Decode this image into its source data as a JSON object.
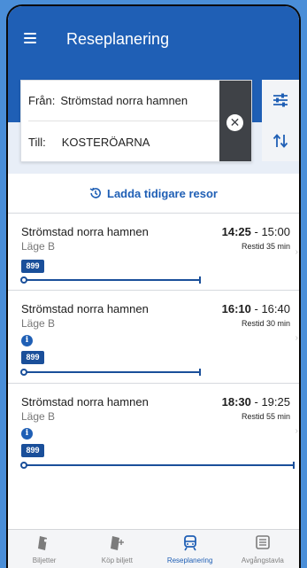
{
  "header": {
    "title": "Reseplanering"
  },
  "search": {
    "from_label": "Från:",
    "from_value": "Strömstad norra hamnen",
    "to_label": "Till:",
    "to_value": "KOSTERÖARNA"
  },
  "load_earlier": "Ladda tidigare resor",
  "trips": [
    {
      "from": "Strömstad norra hamnen",
      "stop": "Läge B",
      "depart": "14:25",
      "separator": "-",
      "arrive": "15:00",
      "duration": "Restid 35 min",
      "route": "899",
      "has_info": false
    },
    {
      "from": "Strömstad norra hamnen",
      "stop": "Läge B",
      "depart": "16:10",
      "separator": "-",
      "arrive": "16:40",
      "duration": "Restid 30 min",
      "route": "899",
      "has_info": true
    },
    {
      "from": "Strömstad norra hamnen",
      "stop": "Läge B",
      "depart": "18:30",
      "separator": "-",
      "arrive": "19:25",
      "duration": "Restid 55 min",
      "route": "899",
      "has_info": true
    }
  ],
  "nav": {
    "tickets": "Biljetter",
    "buy": "Köp biljett",
    "planner": "Reseplanering",
    "departures": "Avgångstavla"
  },
  "colors": {
    "primary": "#1f5fb5",
    "route": "#1a4f9a",
    "clear_bg": "#3f4247"
  },
  "icons": {
    "menu": "hamburger-icon",
    "clear": "close-icon",
    "filter": "sliders-icon",
    "swap": "swap-vertical-icon",
    "history": "history-icon",
    "info": "info-icon",
    "tickets": "ticket-icon",
    "buy": "ticket-plus-icon",
    "planner": "train-icon",
    "departures": "board-icon"
  }
}
